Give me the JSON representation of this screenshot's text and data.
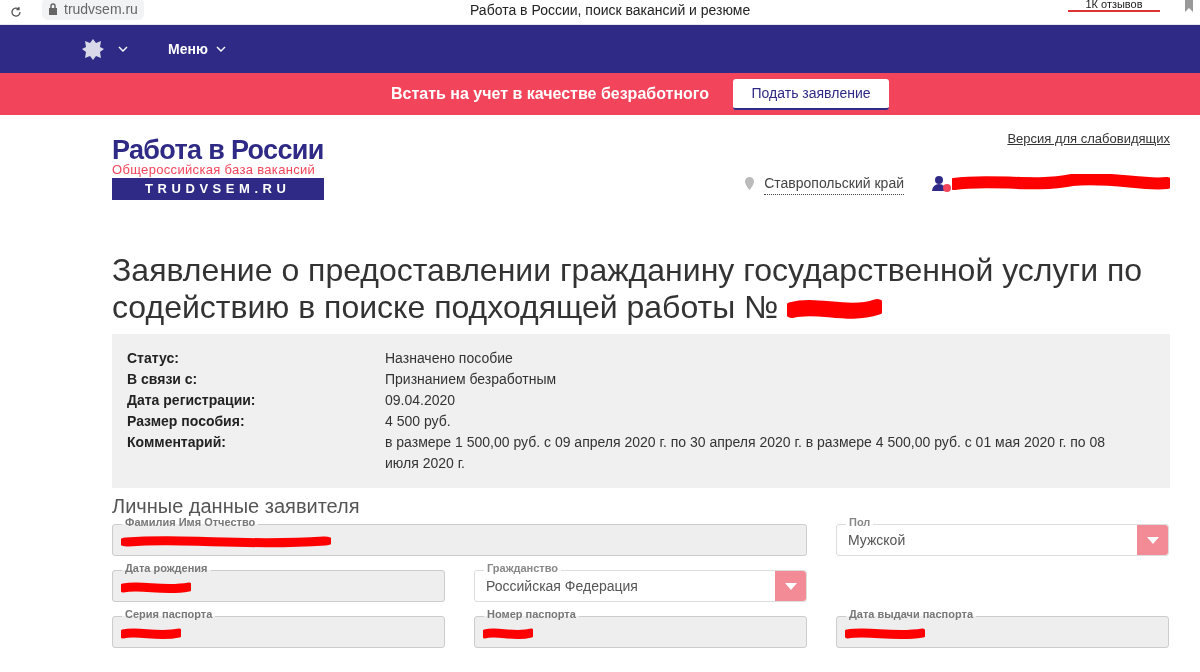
{
  "browser": {
    "url": "trudvsem.ru",
    "title": "Работа в России, поиск вакансий и резюме",
    "reviews": "1К отзывов"
  },
  "nav": {
    "menu": "Меню"
  },
  "banner": {
    "text": "Встать на учет в качестве безработного",
    "button": "Подать заявление"
  },
  "logo": {
    "title": "Работа в России",
    "subtitle": "Общероссийская база вакансий",
    "domain": "TRUDVSEM.RU"
  },
  "header": {
    "accessibility_link": "Версия для слабовидящих",
    "region": "Ставропольский край"
  },
  "page_title": "Заявление о предоставлении гражданину государственной услуги по содействию в поиске подходящей работы №",
  "info": [
    {
      "label": "Статус:",
      "value": "Назначено пособие"
    },
    {
      "label": "В связи с:",
      "value": "Признанием безработным"
    },
    {
      "label": "Дата регистрации:",
      "value": "09.04.2020"
    },
    {
      "label": "Размер пособия:",
      "value": "4 500 руб."
    },
    {
      "label": "Комментарий:",
      "value": "в размере 1 500,00 руб. с 09 апреля 2020 г. по 30 апреля 2020 г. в размере 4 500,00 руб. с 01 мая 2020 г. по 08 июля 2020 г."
    }
  ],
  "section_title": "Личные данные заявителя",
  "fields": [
    {
      "label": "Фамилия Имя Отчество",
      "kind": "wide"
    },
    {
      "label": "Пол",
      "kind": "select",
      "value": "Мужской"
    },
    {
      "label": "Дата рождения",
      "kind": "text"
    },
    {
      "label": "Гражданство",
      "kind": "select",
      "value": "Российская Федерация"
    },
    {
      "kind": "empty"
    },
    {
      "label": "Серия паспорта",
      "kind": "text"
    },
    {
      "label": "Номер паспорта",
      "kind": "text"
    },
    {
      "label": "Дата выдачи паспорта",
      "kind": "text"
    }
  ]
}
